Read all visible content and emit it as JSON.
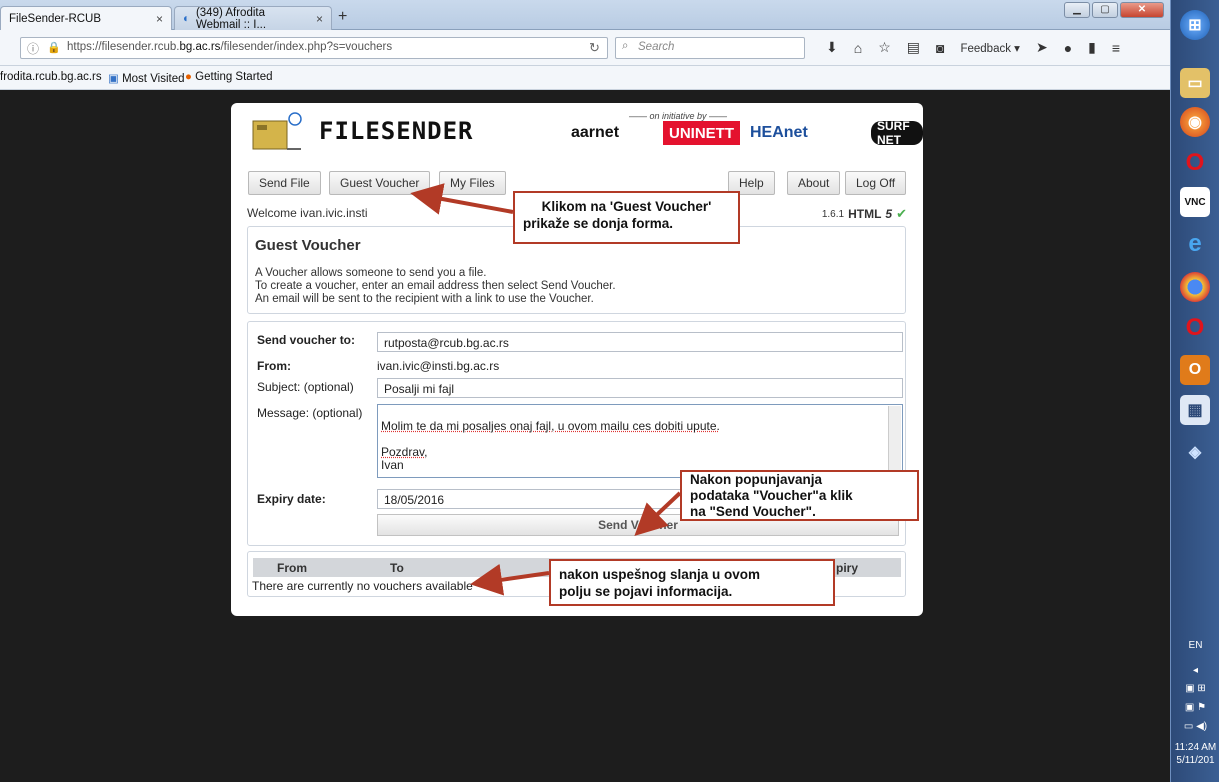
{
  "browser": {
    "tabs": [
      {
        "title": "FileSender-RCUB",
        "close": "×"
      },
      {
        "title": "(349) Afrodita Webmail :: I...",
        "close": "×"
      }
    ],
    "new_tab": "+",
    "url_prefix": "https://filesender.rcub.",
    "url_domain": "bg.ac.rs",
    "url_suffix": "/filesender/index.php?s=vouchers",
    "search_placeholder": "Search",
    "feedback": "Feedback ▾",
    "bookmarks": [
      "frodita.rcub.bg.ac.rs",
      "Most Visited",
      "Getting Started"
    ]
  },
  "header": {
    "logo_text": "FILESENDER",
    "initiative": "—— on initiative by ——",
    "partners": [
      "aarnet",
      "UNINETT",
      "HEAnet",
      "SURF NET"
    ]
  },
  "nav": {
    "send_file": "Send File",
    "guest_voucher": "Guest Voucher",
    "my_files": "My Files",
    "help": "Help",
    "about": "About",
    "logoff": "Log Off"
  },
  "welcome": "Welcome ivan.ivic.insti",
  "version": {
    "number": "1.6.1",
    "html": "HTML",
    "five": "5"
  },
  "guest_voucher": {
    "title": "Guest Voucher",
    "line1": "A Voucher allows someone to send you a file.",
    "line2": "To create a voucher, enter an email address then select Send Voucher.",
    "line3": "An email will be sent to the recipient with a link to use the Voucher."
  },
  "form": {
    "send_to_label": "Send voucher to:",
    "send_to_value": "rutposta@rcub.bg.ac.rs",
    "from_label": "From:",
    "from_value": "ivan.ivic@insti.bg.ac.rs",
    "subject_label": "Subject: (optional)",
    "subject_value": "Posalji mi fajl",
    "message_label": "Message: (optional)",
    "message_line1": "Molim te da mi posaljes onaj fajl, u ovom mailu ces dobiti upute.",
    "message_line2": "Pozdrav,",
    "message_line3": "Ivan",
    "expiry_label": "Expiry date:",
    "expiry_value": "18/05/2016",
    "send_button": "Send Voucher"
  },
  "vouchers_table": {
    "col_from": "From",
    "col_to": "To",
    "col_expiry": "piry",
    "empty_text": "There are currently no vouchers available"
  },
  "annotations": {
    "callout1_line1": "Klikom na 'Guest Voucher'",
    "callout1_line2": "prikaže se donja forma.",
    "callout2_line1": "Nakon popunjavanja",
    "callout2_line2": "podataka  \"Voucher\"a klik",
    "callout2_line3": "na \"Send Voucher\".",
    "callout3_line1": "nakon uspešnog slanja u ovom",
    "callout3_line2": "polju se pojavi informacija."
  },
  "tray": {
    "lang": "EN",
    "time": "11:24 AM",
    "date": "5/11/201"
  },
  "colors": {
    "annotation_red": "#b23a26",
    "check_green": "#4caf50",
    "uninett_red": "#e4122e"
  }
}
